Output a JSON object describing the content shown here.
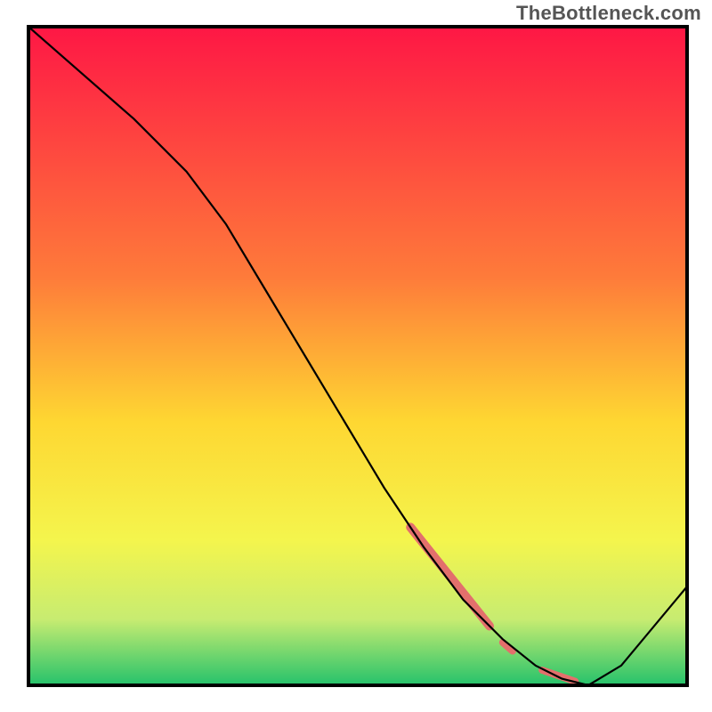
{
  "watermark": "TheBottleneck.com",
  "colors": {
    "frame_stroke": "#000000",
    "curve_stroke": "#000000",
    "highlight": "#e36f6c",
    "grad_top": "#fe1745",
    "grad_mid1": "#fe7b3a",
    "grad_mid2": "#fed732",
    "grad_mid3": "#f4f54d",
    "grad_mid4": "#c7ec71",
    "grad_bottom": "#25c26b"
  },
  "chart_data": {
    "type": "line",
    "title": "",
    "xlabel": "",
    "ylabel": "",
    "xlim": [
      0,
      100
    ],
    "ylim": [
      0,
      100
    ],
    "x": [
      0,
      8,
      16,
      24,
      30,
      36,
      42,
      48,
      54,
      60,
      66,
      72,
      77,
      81,
      85,
      90,
      100
    ],
    "values": [
      100,
      93,
      86,
      78,
      70,
      60,
      50,
      40,
      30,
      21,
      13,
      7,
      3,
      1,
      0,
      3,
      15
    ],
    "note": "Values are approximate percentages inferred from the plotted curve relative to the plot frame height; the background is a vertical gradient from red (top ≈ 100%) through orange/yellow to green (bottom ≈ 0%).",
    "highlight_segments": [
      {
        "x0": 58,
        "y0": 24,
        "x1": 70,
        "y1": 9,
        "width": 10
      },
      {
        "x0": 72,
        "y0": 6.5,
        "x1": 73.5,
        "y1": 5.2,
        "width": 8
      },
      {
        "x0": 78,
        "y0": 2.3,
        "x1": 83,
        "y1": 0.6,
        "width": 8
      }
    ]
  }
}
